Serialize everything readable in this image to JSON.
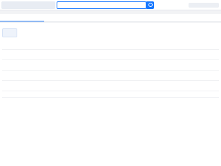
{
  "header": {
    "search_text": ""
  },
  "tabs": [
    "",
    "",
    "",
    "",
    ""
  ],
  "company": {
    "logo_text": "",
    "score": "",
    "score_unit": ""
  },
  "details": [
    [
      {
        "label": "",
        "value": ""
      },
      {
        "label": "",
        "value": ""
      },
      {
        "label": "",
        "value": ""
      }
    ],
    [
      {
        "label": "",
        "value": ""
      },
      {
        "label": "",
        "value": ""
      },
      {
        "label": "",
        "value": ""
      }
    ],
    [
      {
        "label": "",
        "value": ""
      },
      {
        "label": "",
        "value": ""
      },
      {
        "label": "",
        "value": ""
      }
    ],
    [
      {
        "label": "",
        "value": ""
      },
      {
        "label": "",
        "value": ""
      },
      {
        "label": "",
        "value": ""
      }
    ],
    [
      {
        "label": "",
        "value": ""
      },
      {
        "label": "",
        "value": ""
      },
      {
        "label": "",
        "value": ""
      }
    ]
  ],
  "business_scope": {
    "title": "",
    "note": "",
    "text": ""
  },
  "watermark": "",
  "colors": {
    "accent": "#1677ff",
    "page_bg": "#f2f3f5"
  }
}
